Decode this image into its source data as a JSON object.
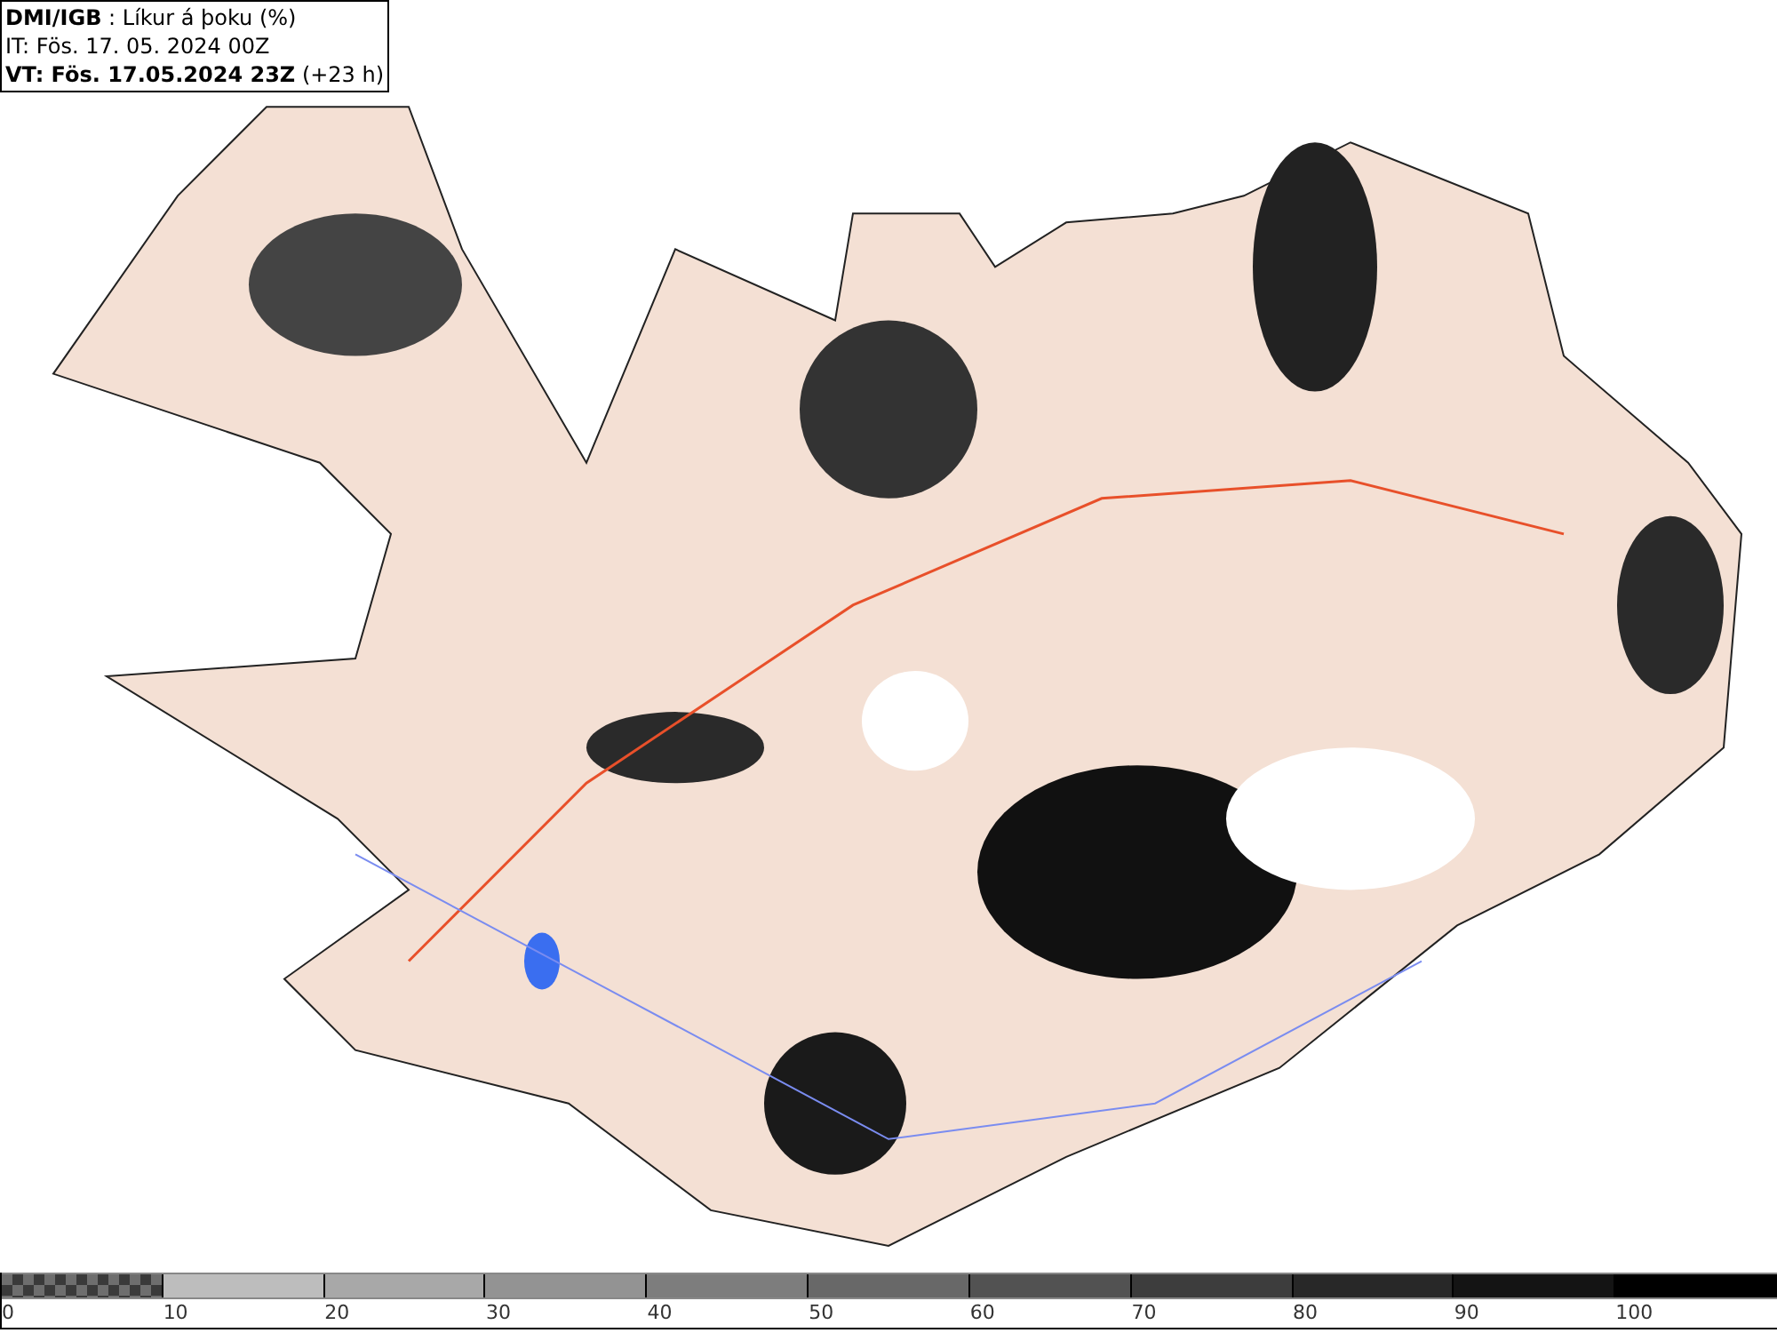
{
  "map": {
    "title_lines": [
      "**DMI/IGB** : Líkur á þoku (%)",
      "IT: Fös. 17. 05. 2024 00Z",
      "**VT: Fös. 17.05.2024 23Z** (+23 h)"
    ]
  },
  "legend": {
    "segments": [
      {
        "kind": "checker",
        "color": "#6e6e6e"
      },
      {
        "kind": "solid",
        "color": "#bdbdbd"
      },
      {
        "kind": "solid",
        "color": "#a8a8a8"
      },
      {
        "kind": "solid",
        "color": "#939393"
      },
      {
        "kind": "solid",
        "color": "#7d7d7d"
      },
      {
        "kind": "solid",
        "color": "#686868"
      },
      {
        "kind": "solid",
        "color": "#525252"
      },
      {
        "kind": "solid",
        "color": "#3d3d3d"
      },
      {
        "kind": "solid",
        "color": "#282828"
      },
      {
        "kind": "solid",
        "color": "#141414"
      },
      {
        "kind": "solid",
        "color": "#000000"
      }
    ],
    "ticks": [
      "0",
      "10",
      "20",
      "30",
      "40",
      "50",
      "60",
      "70",
      "80",
      "90",
      "100"
    ]
  }
}
